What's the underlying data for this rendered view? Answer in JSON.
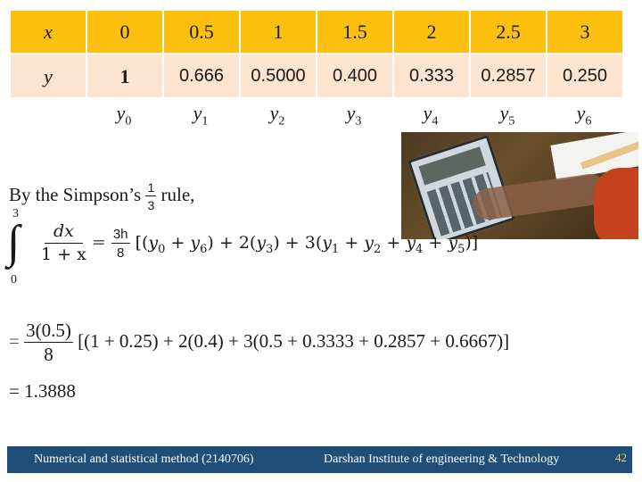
{
  "table": {
    "x_label": "x",
    "y_label": "y",
    "x_values": [
      "0",
      "0.5",
      "1",
      "1.5",
      "2",
      "2.5",
      "3"
    ],
    "y_values": [
      "1",
      "0.666",
      "0.5000",
      "0.400",
      "0.333",
      "0.2857",
      "0.250"
    ],
    "subscript_labels": [
      {
        "base": "y",
        "sub": "0"
      },
      {
        "base": "y",
        "sub": "1"
      },
      {
        "base": "y",
        "sub": "2"
      },
      {
        "base": "y",
        "sub": "3"
      },
      {
        "base": "y",
        "sub": "4"
      },
      {
        "base": "y",
        "sub": "5"
      },
      {
        "base": "y",
        "sub": "6"
      }
    ],
    "header_color": "#fec00f",
    "row_color": "#fde4d0"
  },
  "intro": {
    "prefix": "By the Simpson’s",
    "fraction_num": "1",
    "fraction_den": "3",
    "suffix": "rule,"
  },
  "formula": {
    "upper_limit": "3",
    "lower_limit": "0",
    "integrand_num": "dx",
    "integrand_den": "1 + x",
    "eq": "=",
    "coef_num": "3h",
    "coef_den": "8",
    "rhs": "[(y0 + y6) + 2(y3) + 3(y1 + y2 + y4 + y5)]"
  },
  "substitution": {
    "eq": "=",
    "coef_num": "3(0.5)",
    "coef_den": "8",
    "rhs": "[(1 + 0.25) + 2(0.4) + 3(0.5 + 0.3333 + 0.2857 + 0.6667)]"
  },
  "result": {
    "text": "= 1.3888"
  },
  "image": {
    "description": "calculator-photo"
  },
  "footer": {
    "course": "Numerical and statistical method  (2140706)",
    "institute": "Darshan Institute of engineering & Technology",
    "page_number": "42",
    "bg_color": "#1f4e79",
    "page_color": "#f2d86a"
  }
}
